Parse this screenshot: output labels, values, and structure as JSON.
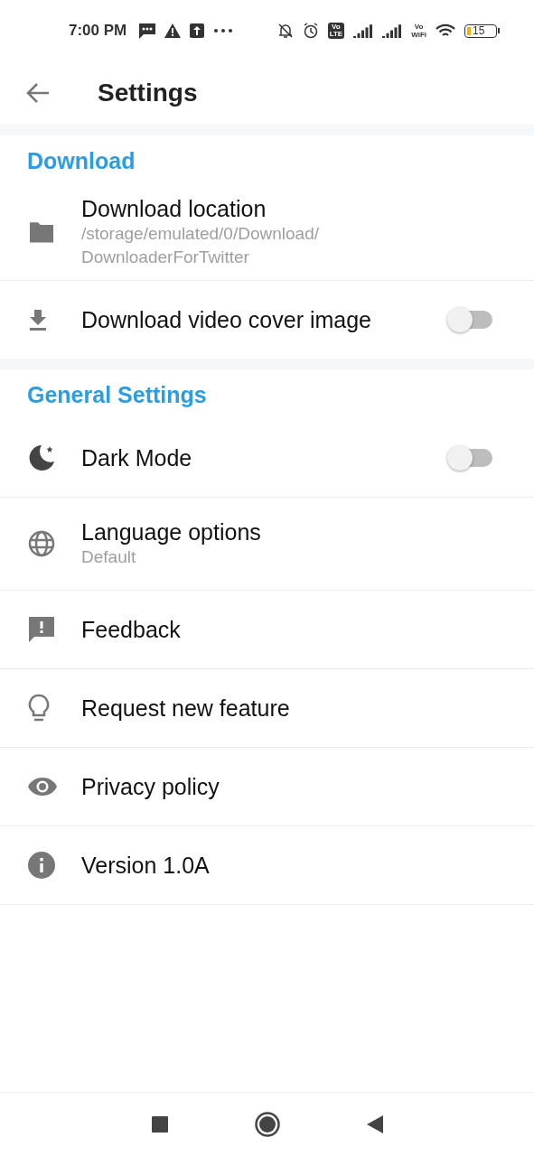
{
  "status_bar": {
    "time": "7:00 PM",
    "volte": [
      "Vo",
      "LTE"
    ],
    "vowifi": [
      "Vo",
      "WiFi"
    ],
    "battery": "15"
  },
  "header": {
    "title": "Settings"
  },
  "sections": [
    {
      "title": "Download",
      "items": [
        {
          "kind": "info",
          "label": "Download location",
          "subtitle": "/storage/emulated/0/Download/\nDownloaderForTwitter"
        },
        {
          "kind": "toggle",
          "label": "Download video cover image",
          "on": false
        }
      ]
    },
    {
      "title": "General Settings",
      "items": [
        {
          "kind": "toggle",
          "label": "Dark Mode",
          "on": false
        },
        {
          "kind": "info",
          "label": "Language options",
          "subtitle": "Default"
        },
        {
          "kind": "info",
          "label": "Feedback"
        },
        {
          "kind": "info",
          "label": "Request new feature"
        },
        {
          "kind": "info",
          "label": "Privacy policy"
        },
        {
          "kind": "info",
          "label": "Version 1.0A"
        }
      ]
    }
  ]
}
